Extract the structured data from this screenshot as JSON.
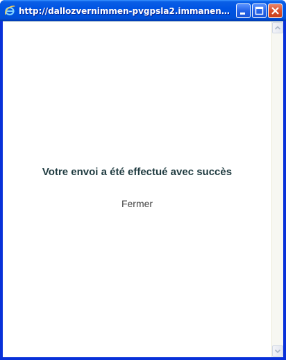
{
  "window": {
    "title": "http://dallozvernimmen-pvgpsla2.immanens.co...",
    "icon": "ie-icon",
    "buttons": {
      "minimize": "minimize-icon",
      "maximize": "maximize-icon",
      "close": "close-icon"
    },
    "colors": {
      "titlebar": "#0054e3",
      "close_button": "#d9502c"
    }
  },
  "content": {
    "message": "Votre envoi a été effectué avec succès",
    "close_link": "Fermer",
    "colors": {
      "message": "#1e3a3f",
      "link": "#444444"
    }
  }
}
